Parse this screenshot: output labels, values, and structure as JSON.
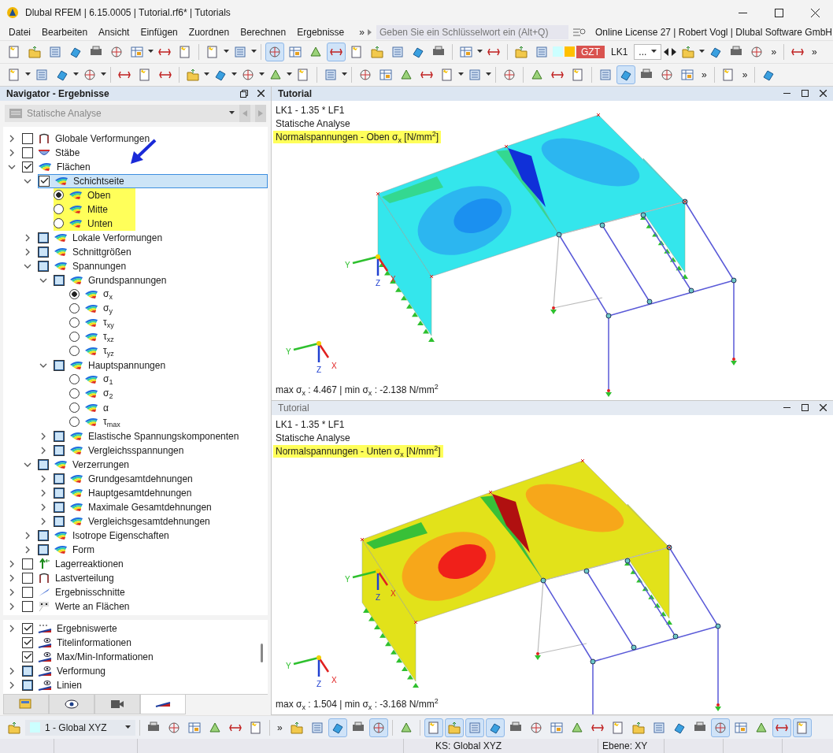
{
  "window": {
    "title": "Dlubal RFEM | 6.15.0005 | Tutorial.rf6* | Tutorials"
  },
  "menu": {
    "items": [
      "Datei",
      "Bearbeiten",
      "Ansicht",
      "Einfügen",
      "Zuordnen",
      "Berechnen",
      "Ergebnisse"
    ],
    "overflow": "»",
    "search_placeholder": "Geben Sie ein Schlüsselwort ein (Alt+Q)",
    "license": "Online License 27 | Robert Vogl | Dlubal Software GmbH"
  },
  "toolbars": [
    {
      "items": [
        {
          "kind": "tool",
          "pressed": false
        },
        {
          "kind": "tool",
          "pressed": false
        },
        {
          "kind": "tool",
          "pressed": false
        },
        {
          "kind": "tool",
          "pressed": false
        },
        {
          "kind": "tool",
          "pressed": false
        },
        {
          "kind": "tool",
          "pressed": false
        },
        {
          "kind": "tool",
          "pressed": false
        },
        {
          "kind": "caret"
        },
        {
          "kind": "tool",
          "pressed": false
        },
        {
          "kind": "tool",
          "pressed": false
        },
        {
          "kind": "sep"
        },
        {
          "kind": "tool",
          "pressed": false
        },
        {
          "kind": "caret"
        },
        {
          "kind": "tool",
          "pressed": false
        },
        {
          "kind": "caret"
        },
        {
          "kind": "sep"
        },
        {
          "kind": "tool",
          "pressed": true
        },
        {
          "kind": "tool",
          "pressed": false
        },
        {
          "kind": "tool",
          "pressed": false
        },
        {
          "kind": "tool",
          "pressed": true
        },
        {
          "kind": "tool",
          "pressed": false
        },
        {
          "kind": "tool",
          "pressed": false
        },
        {
          "kind": "tool",
          "pressed": false
        },
        {
          "kind": "tool",
          "pressed": false
        },
        {
          "kind": "tool",
          "pressed": false
        },
        {
          "kind": "sep"
        },
        {
          "kind": "tool",
          "pressed": false
        },
        {
          "kind": "caret"
        },
        {
          "kind": "tool",
          "pressed": false
        },
        {
          "kind": "sep"
        },
        {
          "kind": "tool",
          "pressed": false
        },
        {
          "kind": "tool",
          "pressed": false
        },
        {
          "kind": "swatch",
          "color": "#ccffff"
        },
        {
          "kind": "swatch",
          "color": "#ffc000"
        },
        {
          "kind": "badge",
          "text": "GZT"
        },
        {
          "kind": "label",
          "text": "LK1"
        },
        {
          "kind": "combo",
          "text": "..."
        },
        {
          "kind": "prev"
        },
        {
          "kind": "next"
        },
        {
          "kind": "tool",
          "pressed": false
        },
        {
          "kind": "caret"
        },
        {
          "kind": "tool",
          "pressed": false
        },
        {
          "kind": "tool",
          "pressed": false
        },
        {
          "kind": "tool",
          "pressed": false
        },
        {
          "kind": "overflow",
          "text": "»"
        },
        {
          "kind": "sep"
        },
        {
          "kind": "tool",
          "pressed": false
        },
        {
          "kind": "overflow",
          "text": "»"
        }
      ]
    },
    {
      "items": [
        {
          "kind": "tool",
          "pressed": false
        },
        {
          "kind": "caret"
        },
        {
          "kind": "tool",
          "pressed": false
        },
        {
          "kind": "tool",
          "pressed": false
        },
        {
          "kind": "caret"
        },
        {
          "kind": "tool",
          "pressed": false
        },
        {
          "kind": "caret"
        },
        {
          "kind": "sep"
        },
        {
          "kind": "tool",
          "pressed": false
        },
        {
          "kind": "tool",
          "pressed": false
        },
        {
          "kind": "tool",
          "pressed": false
        },
        {
          "kind": "sep"
        },
        {
          "kind": "tool",
          "pressed": false
        },
        {
          "kind": "caret"
        },
        {
          "kind": "tool",
          "pressed": false
        },
        {
          "kind": "caret"
        },
        {
          "kind": "tool",
          "pressed": false
        },
        {
          "kind": "caret"
        },
        {
          "kind": "tool",
          "pressed": false
        },
        {
          "kind": "caret"
        },
        {
          "kind": "tool",
          "pressed": false
        },
        {
          "kind": "sep"
        },
        {
          "kind": "tool",
          "pressed": false
        },
        {
          "kind": "caret"
        },
        {
          "kind": "sep"
        },
        {
          "kind": "tool",
          "pressed": false
        },
        {
          "kind": "tool",
          "pressed": false
        },
        {
          "kind": "tool",
          "pressed": false
        },
        {
          "kind": "tool",
          "pressed": false
        },
        {
          "kind": "tool",
          "pressed": false
        },
        {
          "kind": "caret"
        },
        {
          "kind": "tool",
          "pressed": false
        },
        {
          "kind": "caret"
        },
        {
          "kind": "sep"
        },
        {
          "kind": "tool",
          "pressed": false
        },
        {
          "kind": "sep"
        },
        {
          "kind": "tool",
          "pressed": false
        },
        {
          "kind": "tool",
          "pressed": false
        },
        {
          "kind": "tool",
          "pressed": false
        },
        {
          "kind": "sep"
        },
        {
          "kind": "tool",
          "pressed": false
        },
        {
          "kind": "tool",
          "pressed": true
        },
        {
          "kind": "tool",
          "pressed": false
        },
        {
          "kind": "tool",
          "pressed": false
        },
        {
          "kind": "tool",
          "pressed": false
        },
        {
          "kind": "overflow",
          "text": "»"
        },
        {
          "kind": "sep"
        },
        {
          "kind": "tool",
          "pressed": false
        },
        {
          "kind": "overflow",
          "text": "»"
        },
        {
          "kind": "sep"
        },
        {
          "kind": "tool",
          "pressed": false
        }
      ]
    }
  ],
  "navigator": {
    "title": "Navigator - Ergebnisse",
    "dropdown": "Statische Analyse",
    "tree": [
      {
        "label": "Globale Verformungen",
        "kind": "deformation",
        "checked": false,
        "mixed": false,
        "expanded": false,
        "selected": false
      },
      {
        "label": "Stäbe",
        "kind": "members",
        "checked": false,
        "mixed": false,
        "expanded": false,
        "selected": false
      },
      {
        "label": "Flächen",
        "kind": "contour",
        "checked": true,
        "mixed": false,
        "expanded": true,
        "selected": false,
        "children": [
          {
            "label": "Schichtseite",
            "kind": "contour",
            "checked": true,
            "mixed": false,
            "expanded": true,
            "selected": true,
            "children": [
              {
                "label": "Oben",
                "kind": "contour-option",
                "checked": true,
                "highlighted": true,
                "selected": false
              },
              {
                "label": "Mitte",
                "kind": "contour-option",
                "checked": false,
                "highlighted": true,
                "selected": false
              },
              {
                "label": "Unten",
                "kind": "contour-option",
                "checked": false,
                "highlighted": true,
                "selected": false
              }
            ]
          },
          {
            "label": "Lokale Verformungen",
            "kind": "contour",
            "checked": false,
            "mixed": true,
            "expanded": false,
            "selected": false
          },
          {
            "label": "Schnittgrößen",
            "kind": "contour",
            "checked": false,
            "mixed": true,
            "expanded": false,
            "selected": false
          },
          {
            "label": "Spannungen",
            "kind": "contour",
            "checked": false,
            "mixed": true,
            "expanded": true,
            "selected": false,
            "children": [
              {
                "label": "Grundspannungen",
                "kind": "contour",
                "checked": false,
                "mixed": true,
                "expanded": true,
                "selected": false,
                "children": [
                  {
                    "label": "σ$_{x}$",
                    "kind": "contour-option",
                    "checked": true,
                    "selected": false
                  },
                  {
                    "label": "σ$_{y}$",
                    "kind": "contour-option",
                    "checked": false,
                    "selected": false
                  },
                  {
                    "label": "τ$_{xy}$",
                    "kind": "contour-option",
                    "checked": false,
                    "selected": false
                  },
                  {
                    "label": "τ$_{xz}$",
                    "kind": "contour-option",
                    "checked": false,
                    "selected": false
                  },
                  {
                    "label": "τ$_{yz}$",
                    "kind": "contour-option",
                    "checked": false,
                    "selected": false
                  }
                ]
              },
              {
                "label": "Hauptspannungen",
                "kind": "contour",
                "checked": false,
                "mixed": true,
                "expanded": true,
                "selected": false,
                "children": [
                  {
                    "label": "σ$_{1}$",
                    "kind": "contour-option",
                    "checked": false,
                    "selected": false
                  },
                  {
                    "label": "σ$_{2}$",
                    "kind": "contour-option",
                    "checked": false,
                    "selected": false
                  },
                  {
                    "label": "α",
                    "kind": "contour-option",
                    "checked": false,
                    "selected": false
                  },
                  {
                    "label": "τ$_{max}$",
                    "kind": "contour-option",
                    "checked": false,
                    "selected": false
                  }
                ]
              },
              {
                "label": "Elastische Spannungskomponenten",
                "kind": "contour",
                "checked": false,
                "mixed": true,
                "expanded": false,
                "selected": false
              },
              {
                "label": "Vergleichsspannungen",
                "kind": "contour",
                "checked": false,
                "mixed": true,
                "expanded": false,
                "selected": false
              }
            ]
          },
          {
            "label": "Verzerrungen",
            "kind": "contour",
            "checked": false,
            "mixed": true,
            "expanded": true,
            "selected": false,
            "children": [
              {
                "label": "Grundgesamtdehnungen",
                "kind": "contour",
                "checked": false,
                "mixed": true,
                "expanded": false,
                "selected": false
              },
              {
                "label": "Hauptgesamtdehnungen",
                "kind": "contour",
                "checked": false,
                "mixed": true,
                "expanded": false,
                "selected": false
              },
              {
                "label": "Maximale Gesamtdehnungen",
                "kind": "contour",
                "checked": false,
                "mixed": true,
                "expanded": false,
                "selected": false
              },
              {
                "label": "Vergleichsgesamtdehnungen",
                "kind": "contour",
                "checked": false,
                "mixed": true,
                "expanded": false,
                "selected": false
              }
            ]
          },
          {
            "label": "Isotrope Eigenschaften",
            "kind": "contour",
            "checked": false,
            "mixed": true,
            "expanded": false,
            "selected": false
          },
          {
            "label": "Form",
            "kind": "contour",
            "checked": false,
            "mixed": true,
            "expanded": false,
            "selected": false
          }
        ]
      },
      {
        "label": "Lagerreaktionen",
        "kind": "reactions",
        "checked": false,
        "mixed": false,
        "expanded": false,
        "selected": false
      },
      {
        "label": "Lastverteilung",
        "kind": "deformation",
        "checked": false,
        "mixed": false,
        "expanded": false,
        "selected": false
      },
      {
        "label": "Ergebnisschnitte",
        "kind": "cuts",
        "checked": false,
        "mixed": false,
        "expanded": false,
        "selected": false
      },
      {
        "label": "Werte an Flächen",
        "kind": "values",
        "checked": false,
        "mixed": false,
        "expanded": false,
        "selected": false
      }
    ],
    "display_tree": [
      {
        "label": "Ergebniswerte",
        "kind": "values-display",
        "checked": true,
        "mixed": false,
        "expanded": false,
        "selected": false
      },
      {
        "label": "Titelinformationen",
        "kind": "display",
        "checked": true,
        "mixed": false,
        "selected": false
      },
      {
        "label": "Max/Min-Informationen",
        "kind": "display",
        "checked": true,
        "mixed": false,
        "selected": false
      },
      {
        "label": "Verformung",
        "kind": "display",
        "checked": false,
        "mixed": true,
        "expanded": false,
        "selected": false
      },
      {
        "label": "Linien",
        "kind": "display",
        "checked": false,
        "mixed": true,
        "expanded": false,
        "selected": false
      }
    ],
    "tabs": [
      {
        "kind": "data",
        "selected": false
      },
      {
        "kind": "view",
        "selected": false
      },
      {
        "kind": "camera",
        "selected": false
      },
      {
        "kind": "results",
        "selected": true
      }
    ]
  },
  "viewports": [
    {
      "title": "Tutorial",
      "active": true,
      "kind": "top-side",
      "lines": [
        "LK1 - 1.35 * LF1",
        "Statische Analyse"
      ],
      "result_title": "Normalspannungen - Oben σ$_{x}$ [N/mm$^{2}$]",
      "summary": "max σ$_{x}$ : 4.467 | min σ$_{x}$ : -2.138 N/mm$^{2}$",
      "triads": [
        [
          "Y",
          "Z",
          "X"
        ],
        [
          "Y",
          "Z",
          "X"
        ]
      ]
    },
    {
      "title": "Tutorial",
      "active": false,
      "kind": "bottom-side",
      "lines": [
        "LK1 - 1.35 * LF1",
        "Statische Analyse"
      ],
      "result_title": "Normalspannungen - Unten σ$_{x}$ [N/mm$^{2}$]",
      "summary": "max σ$_{x}$ : 1.504 | min σ$_{x}$ : -3.168 N/mm$^{2}$",
      "triads": [
        [
          "Y",
          "Z",
          "X"
        ],
        [
          "Y",
          "Z",
          "X"
        ]
      ]
    }
  ],
  "bottom_toolbar": {
    "items": [
      {
        "kind": "tool",
        "pressed": false
      },
      {
        "kind": "coord",
        "text": "1 - Global XYZ",
        "color": "#ccffff"
      },
      {
        "kind": "sep"
      },
      {
        "kind": "tool",
        "pressed": false
      },
      {
        "kind": "tool",
        "pressed": false
      },
      {
        "kind": "tool",
        "pressed": false
      },
      {
        "kind": "tool",
        "pressed": false
      },
      {
        "kind": "tool",
        "pressed": false
      },
      {
        "kind": "tool",
        "pressed": false
      },
      {
        "kind": "sep"
      },
      {
        "kind": "overflow",
        "text": "»"
      },
      {
        "kind": "tool",
        "pressed": false
      },
      {
        "kind": "tool",
        "pressed": false
      },
      {
        "kind": "tool",
        "pressed": true
      },
      {
        "kind": "tool",
        "pressed": false
      },
      {
        "kind": "tool",
        "pressed": true
      },
      {
        "kind": "sep"
      },
      {
        "kind": "tool",
        "pressed": false
      },
      {
        "kind": "sep"
      },
      {
        "kind": "tool",
        "pressed": true
      },
      {
        "kind": "tool",
        "pressed": true
      },
      {
        "kind": "tool",
        "pressed": true
      },
      {
        "kind": "tool",
        "pressed": true
      },
      {
        "kind": "tool",
        "pressed": false
      },
      {
        "kind": "tool",
        "pressed": false
      },
      {
        "kind": "tool",
        "pressed": false
      },
      {
        "kind": "tool",
        "pressed": false
      },
      {
        "kind": "tool",
        "pressed": false
      },
      {
        "kind": "tool",
        "pressed": false
      },
      {
        "kind": "tool",
        "pressed": false
      },
      {
        "kind": "tool",
        "pressed": false
      },
      {
        "kind": "tool",
        "pressed": false
      },
      {
        "kind": "tool",
        "pressed": false
      },
      {
        "kind": "tool",
        "pressed": true
      },
      {
        "kind": "tool",
        "pressed": false
      },
      {
        "kind": "tool",
        "pressed": false
      },
      {
        "kind": "tool",
        "pressed": true
      },
      {
        "kind": "tool",
        "pressed": true
      }
    ]
  },
  "status_bar": [
    "KS: Global XYZ",
    "Ebene: XY"
  ]
}
